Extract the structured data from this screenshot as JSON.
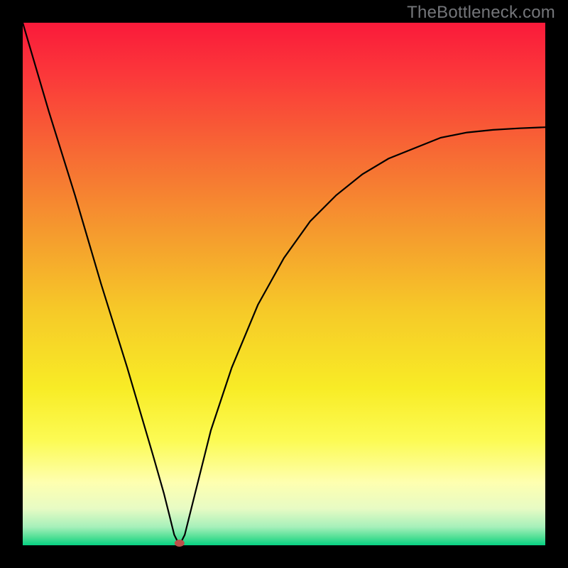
{
  "watermark": "TheBottleneck.com",
  "chart_data": {
    "type": "line",
    "title": "",
    "xlabel": "",
    "ylabel": "",
    "xlim": [
      0,
      100
    ],
    "ylim": [
      0,
      100
    ],
    "grid": false,
    "legend": false,
    "marker": {
      "x": 30,
      "y": 0,
      "color": "#bd4f4a"
    },
    "series": [
      {
        "name": "curve",
        "color": "#000000",
        "x": [
          0,
          5,
          10,
          15,
          20,
          25,
          27,
          28,
          29,
          30,
          31,
          33,
          36,
          40,
          45,
          50,
          55,
          60,
          65,
          70,
          75,
          80,
          85,
          90,
          95,
          100
        ],
        "y": [
          100,
          83,
          67,
          50,
          34,
          17,
          10,
          6,
          2,
          0,
          2,
          10,
          22,
          34,
          46,
          55,
          62,
          67,
          71,
          74,
          76,
          78,
          79,
          79.5,
          79.8,
          80
        ]
      }
    ],
    "gradient_stops": [
      {
        "offset": 0.0,
        "color": "#fa1a3a"
      },
      {
        "offset": 0.1,
        "color": "#fb383a"
      },
      {
        "offset": 0.25,
        "color": "#f76a34"
      },
      {
        "offset": 0.4,
        "color": "#f59a2e"
      },
      {
        "offset": 0.55,
        "color": "#f6c928"
      },
      {
        "offset": 0.7,
        "color": "#f8ec26"
      },
      {
        "offset": 0.8,
        "color": "#fcfb54"
      },
      {
        "offset": 0.88,
        "color": "#feffb0"
      },
      {
        "offset": 0.93,
        "color": "#e7fbc4"
      },
      {
        "offset": 0.965,
        "color": "#a6f0ba"
      },
      {
        "offset": 0.985,
        "color": "#4fdf95"
      },
      {
        "offset": 1.0,
        "color": "#06d183"
      }
    ]
  }
}
